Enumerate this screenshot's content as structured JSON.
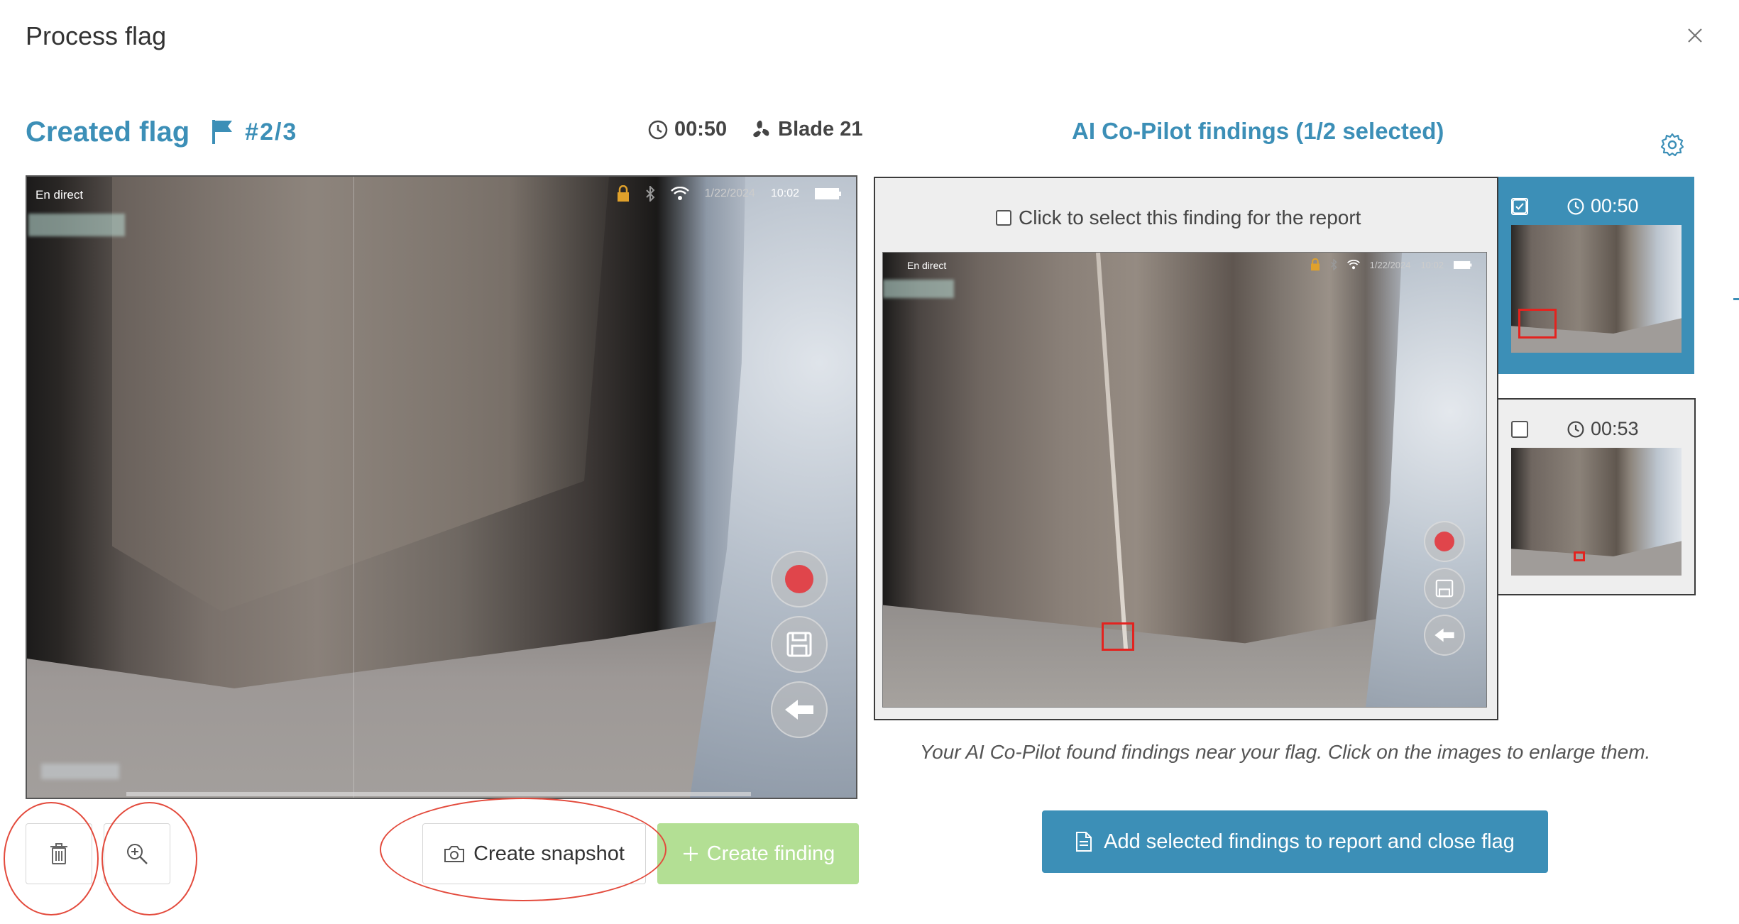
{
  "dialog": {
    "title": "Process flag"
  },
  "flag": {
    "title": "Created flag",
    "number": "#2/3",
    "time": "00:50",
    "blade": "Blade 21"
  },
  "video": {
    "live_label": "En direct",
    "date": "1/22/2024",
    "clock": "10:02"
  },
  "actions": {
    "snapshot_label": "Create snapshot",
    "finding_label": "Create finding"
  },
  "ai": {
    "title": "AI Co-Pilot findings (1/2 selected)",
    "select_label": "Click to select this finding for the report",
    "image_live_label": "En direct",
    "image_date": "1/22/2024",
    "image_clock": "10:02",
    "thumbnails": [
      {
        "time": "00:50",
        "selected": true
      },
      {
        "time": "00:53",
        "selected": false
      }
    ],
    "help_text": "Your AI Co-Pilot found findings near your flag. Click on the images to enlarge them.",
    "add_button_label": "Add selected findings to report and close flag"
  },
  "colors": {
    "accent": "#3c8fb7",
    "finding_button": "#b3df94",
    "annotation_ring": "#e34a3c",
    "detection_box": "#e3231f"
  },
  "icons": [
    "close-icon",
    "flag-icon",
    "clock-icon",
    "fan-icon",
    "gear-icon",
    "trash-icon",
    "zoom-in-icon",
    "camera-icon",
    "plus-icon",
    "document-icon",
    "lock-icon",
    "bluetooth-icon",
    "wifi-icon",
    "battery-icon"
  ]
}
